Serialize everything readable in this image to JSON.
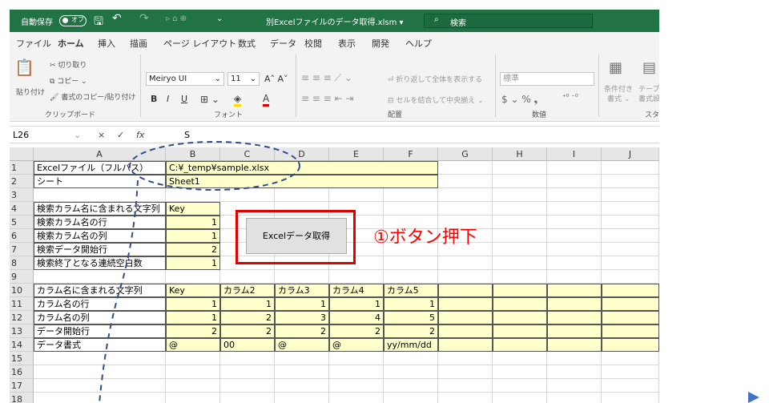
{
  "titlebar": {
    "autosave_label": "自動保存",
    "autosave_state": "オフ",
    "filename": "別Excelファイルのデータ取得.xlsm ▾",
    "search_placeholder": "検索"
  },
  "menu": [
    "ファイル",
    "ホーム",
    "挿入",
    "描画",
    "ページ レイアウト",
    "数式",
    "データ",
    "校閲",
    "表示",
    "開発",
    "ヘルプ"
  ],
  "ribbon": {
    "clipboard": {
      "paste": "貼り付け",
      "cut": "切り取り",
      "copy": "コピー ⌄",
      "format_painter": "書式のコピー/貼り付け",
      "group": "クリップボード"
    },
    "font": {
      "name": "Meiryo UI",
      "size": "11",
      "bold": "B",
      "italic": "I",
      "underline": "U",
      "group": "フォント"
    },
    "alignment": {
      "wrap": "折り返して全体を表示する",
      "merge": "セルを結合して中央揃え ⌄",
      "group": "配置"
    },
    "number": {
      "format": "標準",
      "currency": "$ ⌄ % ❟",
      "group": "数値"
    },
    "styles": {
      "cond": "条件付き",
      "cond2": "書式 ⌄",
      "table": "テーブル",
      "table2": "書式設",
      "group": "スタ"
    }
  },
  "formula_bar": {
    "name_box": "L26",
    "value": "S",
    "cancel": "×",
    "enter": "✓",
    "fx": "fx"
  },
  "columns": [
    "A",
    "B",
    "C",
    "D",
    "E",
    "F",
    "G",
    "H",
    "I",
    "J"
  ],
  "rows": [
    "1",
    "2",
    "3",
    "4",
    "5",
    "6",
    "7",
    "8",
    "9",
    "10",
    "11",
    "12",
    "13",
    "14",
    "15",
    "16",
    "17",
    "18"
  ],
  "cells": {
    "A1": "Excelファイル（フルパス）",
    "B1": "C:¥_temp¥sample.xlsx",
    "A2": "シート",
    "B2": "Sheet1",
    "A4": "検索カラム名に含まれる文字列",
    "B4": "Key",
    "A5": "検索カラム名の行",
    "B5": "1",
    "A6": "検索カラム名の列",
    "B6": "1",
    "A7": "検索データ開始行",
    "B7": "2",
    "A8": "検索終了となる連続空白数",
    "B8": "1",
    "A10": "カラム名に含まれる文字列",
    "B10": "Key",
    "C10": "カラム2",
    "D10": "カラム3",
    "E10": "カラム4",
    "F10": "カラム5",
    "A11": "カラム名の行",
    "B11": "1",
    "C11": "1",
    "D11": "1",
    "E11": "1",
    "F11": "1",
    "A12": "カラム名の列",
    "B12": "1",
    "C12": "2",
    "D12": "3",
    "E12": "4",
    "F12": "5",
    "A13": "データ開始行",
    "B13": "2",
    "C13": "2",
    "D13": "2",
    "E13": "2",
    "F13": "2",
    "A14": "データ書式",
    "B14": "@",
    "C14": "00",
    "D14": "@",
    "E14": "@",
    "F14": "yy/mm/dd"
  },
  "button": {
    "label": "Excelデータ取得"
  },
  "annotation": {
    "callout": "①ボタン押下",
    "highlight_color": "#e00000",
    "dash_color": "#2f4d8a"
  },
  "colors": {
    "excel_green": "#217346",
    "input_fill": "#ffffcc"
  }
}
